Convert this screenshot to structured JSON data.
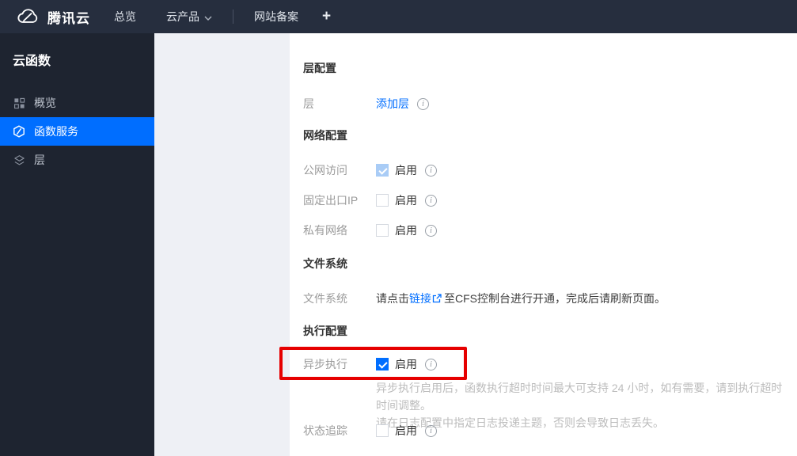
{
  "topbar": {
    "brand": "腾讯云",
    "nav": {
      "overview": "总览",
      "products": "云产品",
      "icp": "网站备案",
      "add": "+"
    }
  },
  "sidebar": {
    "title": "云函数",
    "items": {
      "overview": "概览",
      "functions": "函数服务",
      "layers": "层"
    },
    "active_item": "函数服务"
  },
  "content": {
    "layer_config": {
      "heading": "层配置",
      "layer_label": "层",
      "add_layer_link": "添加层"
    },
    "network_config": {
      "heading": "网络配置",
      "public_access": {
        "label": "公网访问",
        "enable_label": "启用",
        "checked": true,
        "disabled": true
      },
      "fixed_egress_ip": {
        "label": "固定出口IP",
        "enable_label": "启用",
        "checked": false
      },
      "private_network": {
        "label": "私有网络",
        "enable_label": "启用",
        "checked": false
      }
    },
    "file_system": {
      "heading": "文件系统",
      "label": "文件系统",
      "text_before_link": "请点击",
      "link_text": "链接",
      "text_after_link": "至CFS控制台进行开通，完成后请刷新页面。"
    },
    "execution_config": {
      "heading": "执行配置",
      "async_execution": {
        "label": "异步执行",
        "enable_label": "启用",
        "checked": true,
        "helper_line1": "异步执行启用后，函数执行超时时间最大可支持 24 小时，如有需要，请到执行超时时间调整。",
        "helper_line2": "请在日志配置中指定日志投递主题，否则会导致日志丢失。"
      },
      "status_tracking": {
        "label": "状态追踪",
        "enable_label": "启用",
        "checked": false
      }
    }
  },
  "annotation": {
    "type": "highlight-box",
    "color": "#e60000",
    "target_row": "异步执行"
  },
  "colors": {
    "accent_blue": "#006eff",
    "topbar_bg": "#262e3e",
    "sidebar_bg": "#1e2430",
    "page_bg": "#eef0f5",
    "highlight_red": "#e60000"
  }
}
